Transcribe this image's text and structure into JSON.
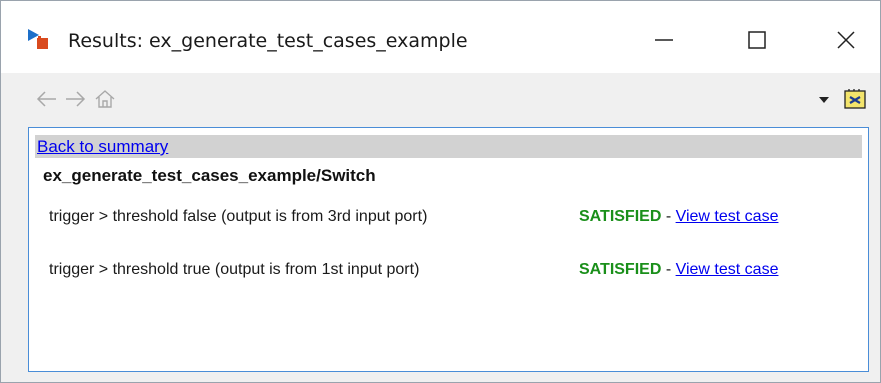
{
  "window": {
    "title": "Results: ex_generate_test_cases_example",
    "icons": {
      "app": "simulink-model-icon",
      "minimize": "minimize-icon",
      "maximize": "maximize-icon",
      "close": "close-icon"
    }
  },
  "toolbar": {
    "icons": [
      "back-arrow-icon",
      "forward-arrow-icon",
      "home-icon",
      "chevron-down-icon",
      "options-icon"
    ]
  },
  "report": {
    "back_link": "Back to summary",
    "block_title": "ex_generate_test_cases_example/Switch",
    "objectives": [
      {
        "description": "trigger > threshold false (output is from 3rd input port)",
        "status": "SATISFIED",
        "separator": " - ",
        "link": "View test case"
      },
      {
        "description": "trigger > threshold true (output is from 1st input port)",
        "status": "SATISFIED",
        "separator": " - ",
        "link": "View test case"
      }
    ]
  },
  "colors": {
    "satisfied": "#1a8f1a",
    "link": "#0000ee",
    "content_border": "#4a8dd7",
    "back_row_bg": "#d2d2d2",
    "toolbar_bg": "#f0f0f0"
  }
}
